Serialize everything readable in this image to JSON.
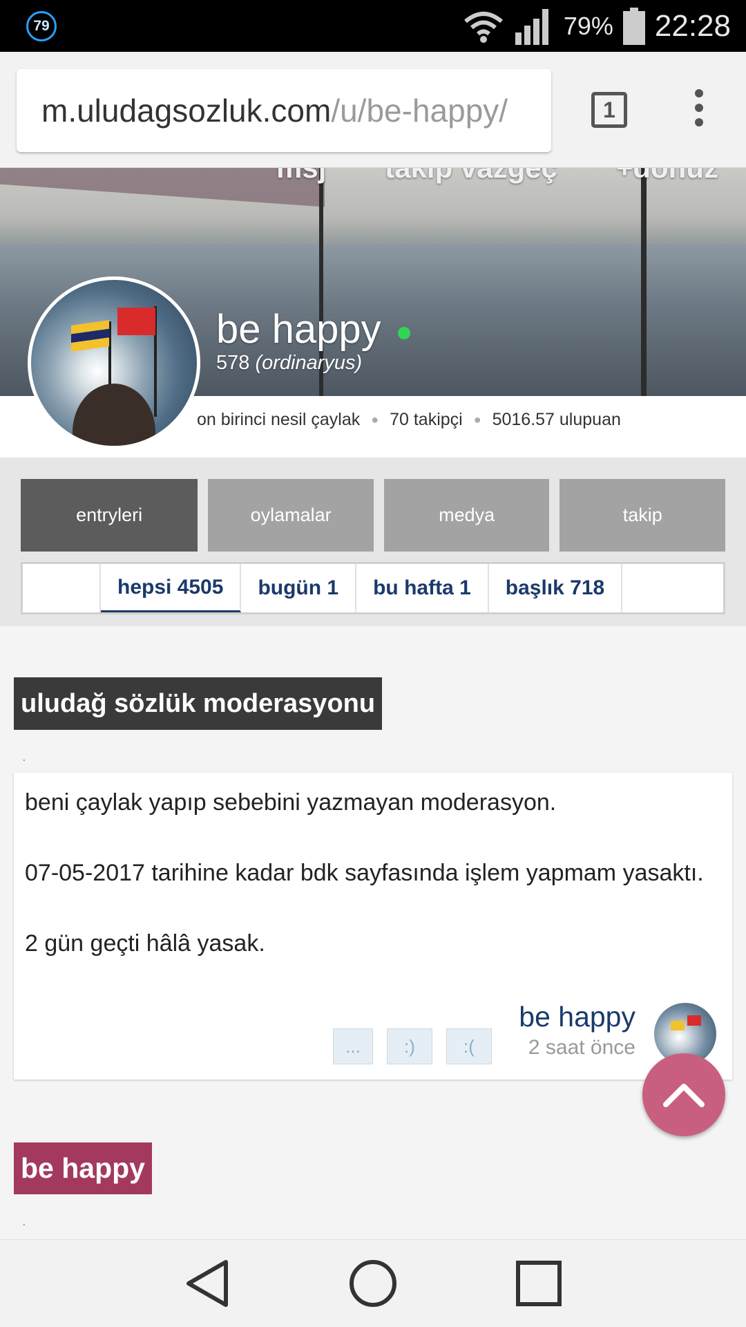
{
  "status_bar": {
    "notification_badge": "79",
    "battery_percent": "79%",
    "time": "22:28"
  },
  "browser": {
    "url_domain": "m.uludagsozluk.com",
    "url_path": "/u/be-happy/",
    "tab_count": "1"
  },
  "profile": {
    "cover_links": [
      "msj",
      "takip vazgeç",
      "+dönüz"
    ],
    "name": "be happy",
    "score": "578",
    "rank": "(ordinaryus)",
    "status": "on birinci nesil çaylak",
    "followers": "70 takipçi",
    "points": "5016.57 ulupuan"
  },
  "main_tabs": [
    "entryleri",
    "oylamalar",
    "medya",
    "takip"
  ],
  "sub_tabs": [
    "hepsi 4505",
    "bugün 1",
    "bu hafta 1",
    "başlık 718"
  ],
  "entries": [
    {
      "topic": "uludağ sözlük moderasyonu",
      "paragraphs": [
        "beni çaylak yapıp sebebini yazmayan moderasyon.",
        "07-05-2017 tarihine kadar bdk sayfasında işlem yapmam yasaktı.",
        "2 gün geçti hâlâ yasak."
      ],
      "votes": [
        "...",
        ":)",
        ":("
      ],
      "author": "be happy",
      "time": "2 saat önce"
    }
  ],
  "next_topic": "be happy",
  "colors": {
    "accent_navy": "#1b3a6b",
    "topic_dark": "#3a3a3a",
    "topic_pink": "#a3395f",
    "fab": "#c95f7e",
    "online": "#31d455"
  }
}
